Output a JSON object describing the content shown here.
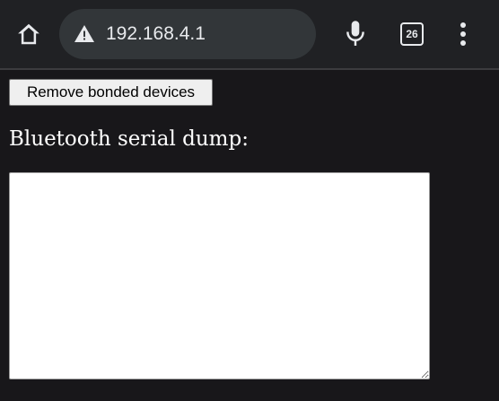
{
  "browser": {
    "url": "192.168.4.1",
    "tab_count": "26",
    "icons": {
      "home": "home-icon",
      "security_warning": "warning-icon",
      "voice": "mic-icon",
      "tabs": "tab-switcher-icon",
      "menu": "more-vert-icon"
    }
  },
  "page": {
    "remove_button_label": "Remove bonded devices",
    "dump_label": "Bluetooth serial dump:",
    "dump_value": ""
  },
  "colors": {
    "toolbar_bg": "#202124",
    "omnibox_bg": "#323639",
    "page_bg": "#18171a"
  }
}
